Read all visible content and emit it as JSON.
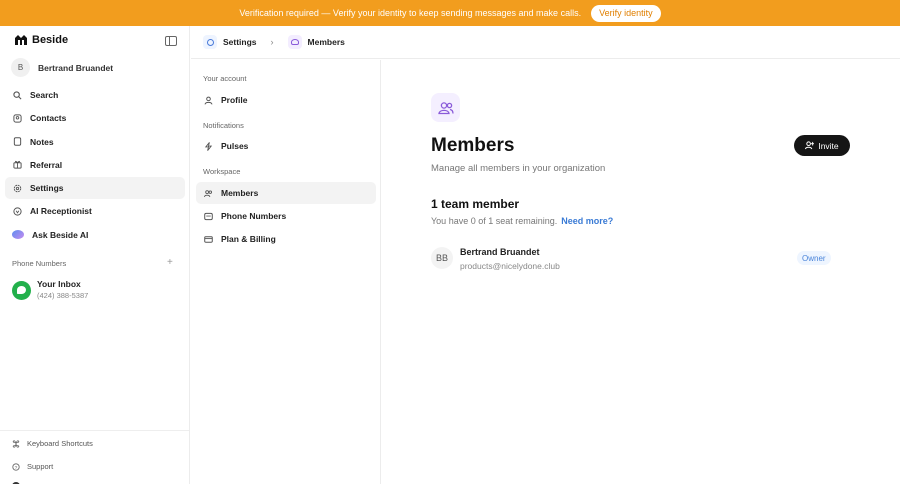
{
  "banner": {
    "message": "Verification required — Verify your identity to keep sending messages and make calls.",
    "verify_label": "Verify identity"
  },
  "sidebar": {
    "app_name": "Beside",
    "user": {
      "initial": "B",
      "name": "Bertrand Bruandet"
    },
    "items": [
      {
        "label": "Search",
        "icon": "search-icon"
      },
      {
        "label": "Contacts",
        "icon": "contacts-icon"
      },
      {
        "label": "Notes",
        "icon": "notes-icon"
      },
      {
        "label": "Referral",
        "icon": "referral-icon"
      },
      {
        "label": "Settings",
        "icon": "gear-icon",
        "active": true
      },
      {
        "label": "AI Receptionist",
        "icon": "ai-receptionist-icon"
      },
      {
        "label": "Ask Beside AI",
        "icon": "ai-orb-icon"
      }
    ],
    "phone_numbers_label": "Phone Numbers",
    "inbox": {
      "title": "Your Inbox",
      "number": "(424) 388-5387"
    },
    "bottom": [
      {
        "label": "Keyboard Shortcuts",
        "icon": "keyboard-icon"
      },
      {
        "label": "Support",
        "icon": "help-icon"
      }
    ]
  },
  "header": {
    "crumbs": [
      {
        "label": "Settings",
        "icon": "gear-icon"
      },
      {
        "label": "Members",
        "icon": "people-icon"
      }
    ]
  },
  "settings_nav": {
    "sections": [
      {
        "label": "Your account",
        "items": [
          {
            "label": "Profile",
            "icon": "person-icon"
          }
        ]
      },
      {
        "label": "Notifications",
        "items": [
          {
            "label": "Pulses",
            "icon": "pulse-icon"
          }
        ]
      },
      {
        "label": "Workspace",
        "items": [
          {
            "label": "Members",
            "icon": "people-icon",
            "active": true
          },
          {
            "label": "Phone Numbers",
            "icon": "phone-icon"
          },
          {
            "label": "Plan & Billing",
            "icon": "billing-icon"
          }
        ]
      }
    ]
  },
  "main": {
    "title": "Members",
    "subtitle": "Manage all members in your organization",
    "invite_label": "Invite",
    "count_title": "1 team member",
    "seats_text": "You have 0 of 1 seat remaining.",
    "need_more_label": "Need more?",
    "members": [
      {
        "initials": "BB",
        "name": "Bertrand Bruandet",
        "email": "products@nicelydone.club",
        "role": "Owner"
      }
    ]
  },
  "colors": {
    "banner": "#f29d1e",
    "accent_blue": "#3a7bd5",
    "invite_bg": "#151515",
    "inbox_green": "#22b04b"
  }
}
